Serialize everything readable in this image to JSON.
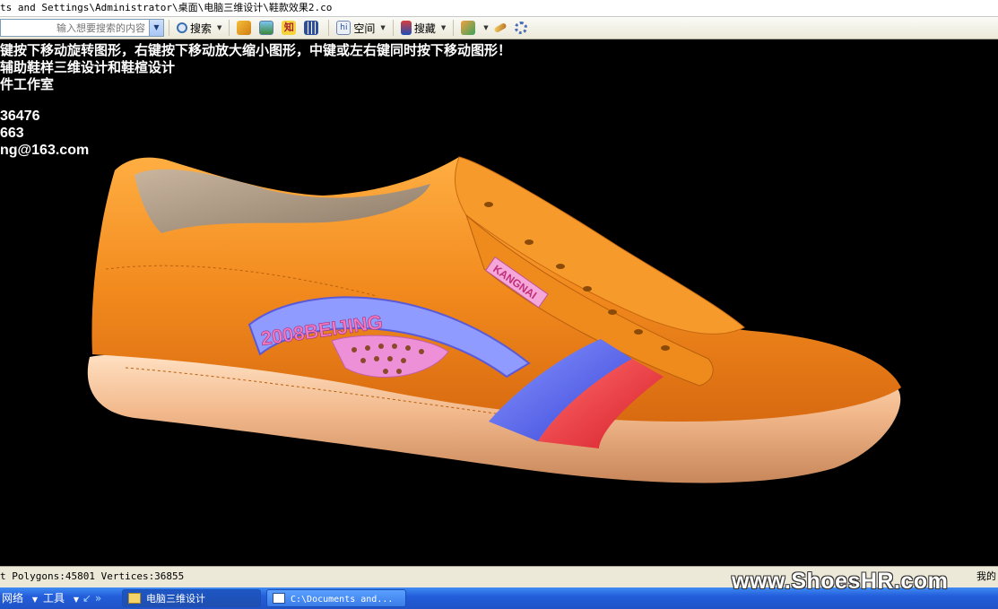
{
  "window": {
    "path_title": "ts and Settings\\Administrator\\桌面\\电脑三维设计\\鞋款效果2.co"
  },
  "toolbar": {
    "search_placeholder": "输入想要搜索的内容",
    "search_label": "搜索",
    "space_label": "空间",
    "bookmark_label": "搜藏"
  },
  "viewport": {
    "instruction_line": "键按下移动旋转图形，右键按下移动放大缩小图形，中键或左右键同时按下移动图形！",
    "line2": "辅助鞋样三维设计和鞋楦设计",
    "line3": "件工作室",
    "line4": "36476",
    "line5": "663",
    "line6": "ng@163.com",
    "background": "#000000"
  },
  "shoe": {
    "upper_color": "#f28a1e",
    "sole_color": "#f6c39a",
    "badge_text": "2008BEIJING",
    "tag_text": "KANGNAI",
    "stripe_colors": [
      "#4a55e8",
      "#e83030"
    ]
  },
  "statusbar": {
    "stats": "t Polygons:45801 Vertices:36855",
    "right_text": "我的"
  },
  "taskbar": {
    "network_label": "网络",
    "tools_label": "工具",
    "task1": "电脑三维设计",
    "task2": "C:\\Documents and..."
  },
  "watermark": "www.ShoesHR.com"
}
